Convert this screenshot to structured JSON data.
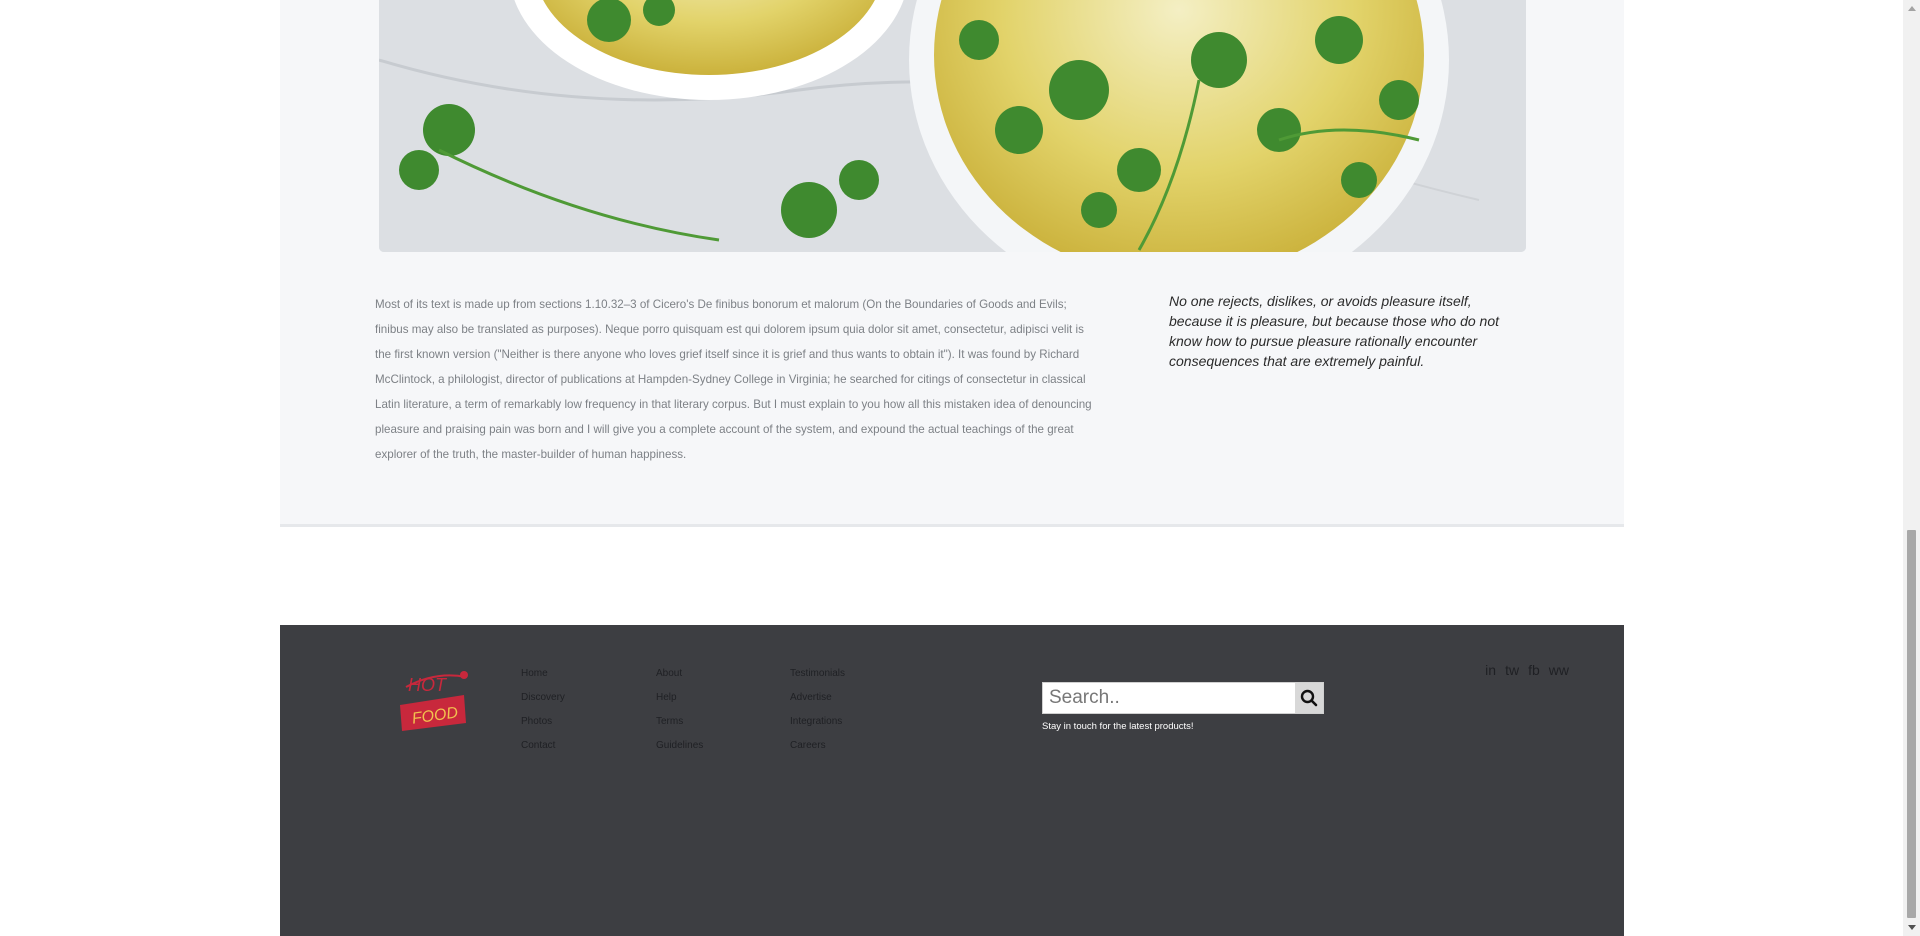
{
  "article": {
    "hero_image": "thai-coconut-soup-bowls-photo",
    "body_text": "Most of its text is made up from sections 1.10.32–3 of Cicero's De finibus bonorum et malorum (On the Boundaries of Goods and Evils; finibus may also be translated as purposes). Neque porro quisquam est qui dolorem ipsum quia dolor sit amet, consectetur, adipisci velit is the first known version (\"Neither is there anyone who loves grief itself since it is grief and thus wants to obtain it\"). It was found by Richard McClintock, a philologist, director of publications at Hampden-Sydney College in Virginia; he searched for citings of consectetur in classical Latin literature, a term of remarkably low frequency in that literary corpus. But I must explain to you how all this mistaken idea of denouncing pleasure and praising pain was born and I will give you a complete account of the system, and expound the actual teachings of the great explorer of the truth, the master-builder of human happiness.",
    "quote": "No one rejects, dislikes, or avoids pleasure itself, because it is pleasure, but because those who do not know how to pursue pleasure rationally encounter consequences that are extremely painful."
  },
  "footer": {
    "logo": {
      "line1": "HOT",
      "line2": "FOOD"
    },
    "columns": [
      [
        "Home",
        "Discovery",
        "Photos",
        "Contact"
      ],
      [
        "About",
        "Help",
        "Terms",
        "Guidelines"
      ],
      [
        "Testimonials",
        "Advertise",
        "Integrations",
        "Careers"
      ]
    ],
    "search": {
      "placeholder": "Search..",
      "icon": "search-icon"
    },
    "tagline": "Stay in touch for the latest products!",
    "social": [
      "in",
      "tw",
      "fb",
      "ww"
    ]
  },
  "colors": {
    "card_bg": "#f6f7f9",
    "footer_bg": "#3d3e42",
    "logo_red": "#c8283c",
    "logo_yellow": "#f2c14e"
  }
}
